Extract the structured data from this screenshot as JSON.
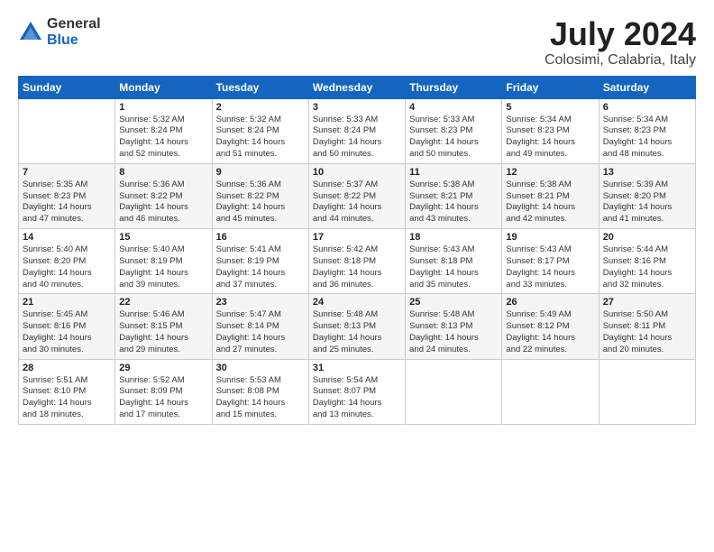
{
  "header": {
    "logo_general": "General",
    "logo_blue": "Blue",
    "main_title": "July 2024",
    "subtitle": "Colosimi, Calabria, Italy"
  },
  "calendar": {
    "days_of_week": [
      "Sunday",
      "Monday",
      "Tuesday",
      "Wednesday",
      "Thursday",
      "Friday",
      "Saturday"
    ],
    "weeks": [
      [
        {
          "day": "",
          "info": ""
        },
        {
          "day": "1",
          "info": "Sunrise: 5:32 AM\nSunset: 8:24 PM\nDaylight: 14 hours\nand 52 minutes."
        },
        {
          "day": "2",
          "info": "Sunrise: 5:32 AM\nSunset: 8:24 PM\nDaylight: 14 hours\nand 51 minutes."
        },
        {
          "day": "3",
          "info": "Sunrise: 5:33 AM\nSunset: 8:24 PM\nDaylight: 14 hours\nand 50 minutes."
        },
        {
          "day": "4",
          "info": "Sunrise: 5:33 AM\nSunset: 8:23 PM\nDaylight: 14 hours\nand 50 minutes."
        },
        {
          "day": "5",
          "info": "Sunrise: 5:34 AM\nSunset: 8:23 PM\nDaylight: 14 hours\nand 49 minutes."
        },
        {
          "day": "6",
          "info": "Sunrise: 5:34 AM\nSunset: 8:23 PM\nDaylight: 14 hours\nand 48 minutes."
        }
      ],
      [
        {
          "day": "7",
          "info": "Sunrise: 5:35 AM\nSunset: 8:23 PM\nDaylight: 14 hours\nand 47 minutes."
        },
        {
          "day": "8",
          "info": "Sunrise: 5:36 AM\nSunset: 8:22 PM\nDaylight: 14 hours\nand 46 minutes."
        },
        {
          "day": "9",
          "info": "Sunrise: 5:36 AM\nSunset: 8:22 PM\nDaylight: 14 hours\nand 45 minutes."
        },
        {
          "day": "10",
          "info": "Sunrise: 5:37 AM\nSunset: 8:22 PM\nDaylight: 14 hours\nand 44 minutes."
        },
        {
          "day": "11",
          "info": "Sunrise: 5:38 AM\nSunset: 8:21 PM\nDaylight: 14 hours\nand 43 minutes."
        },
        {
          "day": "12",
          "info": "Sunrise: 5:38 AM\nSunset: 8:21 PM\nDaylight: 14 hours\nand 42 minutes."
        },
        {
          "day": "13",
          "info": "Sunrise: 5:39 AM\nSunset: 8:20 PM\nDaylight: 14 hours\nand 41 minutes."
        }
      ],
      [
        {
          "day": "14",
          "info": "Sunrise: 5:40 AM\nSunset: 8:20 PM\nDaylight: 14 hours\nand 40 minutes."
        },
        {
          "day": "15",
          "info": "Sunrise: 5:40 AM\nSunset: 8:19 PM\nDaylight: 14 hours\nand 39 minutes."
        },
        {
          "day": "16",
          "info": "Sunrise: 5:41 AM\nSunset: 8:19 PM\nDaylight: 14 hours\nand 37 minutes."
        },
        {
          "day": "17",
          "info": "Sunrise: 5:42 AM\nSunset: 8:18 PM\nDaylight: 14 hours\nand 36 minutes."
        },
        {
          "day": "18",
          "info": "Sunrise: 5:43 AM\nSunset: 8:18 PM\nDaylight: 14 hours\nand 35 minutes."
        },
        {
          "day": "19",
          "info": "Sunrise: 5:43 AM\nSunset: 8:17 PM\nDaylight: 14 hours\nand 33 minutes."
        },
        {
          "day": "20",
          "info": "Sunrise: 5:44 AM\nSunset: 8:16 PM\nDaylight: 14 hours\nand 32 minutes."
        }
      ],
      [
        {
          "day": "21",
          "info": "Sunrise: 5:45 AM\nSunset: 8:16 PM\nDaylight: 14 hours\nand 30 minutes."
        },
        {
          "day": "22",
          "info": "Sunrise: 5:46 AM\nSunset: 8:15 PM\nDaylight: 14 hours\nand 29 minutes."
        },
        {
          "day": "23",
          "info": "Sunrise: 5:47 AM\nSunset: 8:14 PM\nDaylight: 14 hours\nand 27 minutes."
        },
        {
          "day": "24",
          "info": "Sunrise: 5:48 AM\nSunset: 8:13 PM\nDaylight: 14 hours\nand 25 minutes."
        },
        {
          "day": "25",
          "info": "Sunrise: 5:48 AM\nSunset: 8:13 PM\nDaylight: 14 hours\nand 24 minutes."
        },
        {
          "day": "26",
          "info": "Sunrise: 5:49 AM\nSunset: 8:12 PM\nDaylight: 14 hours\nand 22 minutes."
        },
        {
          "day": "27",
          "info": "Sunrise: 5:50 AM\nSunset: 8:11 PM\nDaylight: 14 hours\nand 20 minutes."
        }
      ],
      [
        {
          "day": "28",
          "info": "Sunrise: 5:51 AM\nSunset: 8:10 PM\nDaylight: 14 hours\nand 18 minutes."
        },
        {
          "day": "29",
          "info": "Sunrise: 5:52 AM\nSunset: 8:09 PM\nDaylight: 14 hours\nand 17 minutes."
        },
        {
          "day": "30",
          "info": "Sunrise: 5:53 AM\nSunset: 8:08 PM\nDaylight: 14 hours\nand 15 minutes."
        },
        {
          "day": "31",
          "info": "Sunrise: 5:54 AM\nSunset: 8:07 PM\nDaylight: 14 hours\nand 13 minutes."
        },
        {
          "day": "",
          "info": ""
        },
        {
          "day": "",
          "info": ""
        },
        {
          "day": "",
          "info": ""
        }
      ]
    ]
  }
}
